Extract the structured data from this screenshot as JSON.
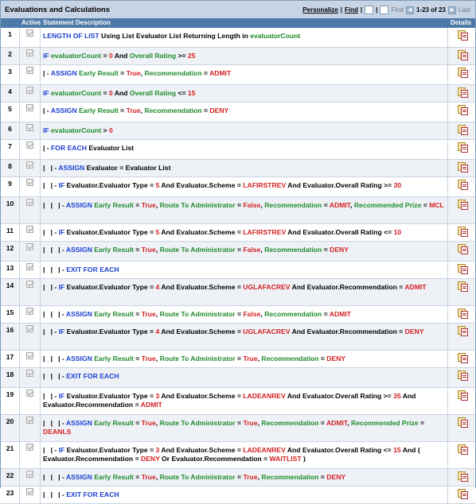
{
  "title": "Evaluations and Calculations",
  "nav": {
    "personalize": "Personalize",
    "find": "Find",
    "first": "First",
    "range": "1-23 of 23",
    "last": "Last"
  },
  "headers": {
    "active": "Active",
    "description": "Statement Description",
    "details": "Details"
  },
  "rows": [
    {
      "num": "1",
      "height": 24,
      "tokens": [
        [
          "k",
          "LENGTH OF LIST"
        ],
        [
          "t",
          " Using "
        ],
        [
          "t",
          "List Evaluator List"
        ],
        [
          "t",
          " Returning Length in "
        ],
        [
          "f",
          "evaluatorCount"
        ]
      ]
    },
    {
      "num": "2",
      "height": 21,
      "tokens": [
        [
          "k",
          "IF "
        ],
        [
          "f",
          "evaluatorCount"
        ],
        [
          "t",
          " = "
        ],
        [
          "v",
          "0"
        ],
        [
          "t",
          " And "
        ],
        [
          "f",
          "Overall Rating"
        ],
        [
          "t",
          " >= "
        ],
        [
          "v",
          "25"
        ]
      ]
    },
    {
      "num": "3",
      "height": 24,
      "tokens": [
        [
          "t",
          "| - "
        ],
        [
          "k",
          "ASSIGN "
        ],
        [
          "f",
          "Early Result"
        ],
        [
          "t",
          " = "
        ],
        [
          "v",
          "True"
        ],
        [
          "t",
          ", "
        ],
        [
          "f",
          "Recommendation"
        ],
        [
          "t",
          " = "
        ],
        [
          "v",
          "ADMIT"
        ]
      ]
    },
    {
      "num": "4",
      "height": 21,
      "tokens": [
        [
          "k",
          "IF "
        ],
        [
          "f",
          "evaluatorCount"
        ],
        [
          "t",
          " = "
        ],
        [
          "v",
          "0"
        ],
        [
          "t",
          " And "
        ],
        [
          "f",
          "Overall Rating"
        ],
        [
          "t",
          " <= "
        ],
        [
          "v",
          "15"
        ]
      ]
    },
    {
      "num": "5",
      "height": 24,
      "tokens": [
        [
          "t",
          "| - "
        ],
        [
          "k",
          "ASSIGN "
        ],
        [
          "f",
          "Early Result"
        ],
        [
          "t",
          " = "
        ],
        [
          "v",
          "True"
        ],
        [
          "t",
          ", "
        ],
        [
          "f",
          "Recommendation"
        ],
        [
          "t",
          " = "
        ],
        [
          "v",
          "DENY"
        ]
      ]
    },
    {
      "num": "6",
      "height": 21,
      "tokens": [
        [
          "k",
          "IF "
        ],
        [
          "f",
          "evaluatorCount"
        ],
        [
          "t",
          " > "
        ],
        [
          "v",
          "0"
        ]
      ]
    },
    {
      "num": "7",
      "height": 24,
      "tokens": [
        [
          "t",
          "| - "
        ],
        [
          "k",
          "FOR EACH "
        ],
        [
          "t",
          "Evaluator List"
        ]
      ]
    },
    {
      "num": "8",
      "height": 21,
      "tokens": [
        [
          "t",
          "|   | - "
        ],
        [
          "k",
          "ASSIGN "
        ],
        [
          "t",
          "Evaluator"
        ],
        [
          "t",
          " = "
        ],
        [
          "t",
          "Evaluator List"
        ]
      ]
    },
    {
      "num": "9",
      "height": 24,
      "tokens": [
        [
          "t",
          "|   | - "
        ],
        [
          "k",
          "IF "
        ],
        [
          "t",
          "Evaluator.Evaluator Type"
        ],
        [
          "t",
          " = "
        ],
        [
          "v",
          "5"
        ],
        [
          "t",
          " And "
        ],
        [
          "t",
          "Evaluator.Scheme"
        ],
        [
          "t",
          " = "
        ],
        [
          "v",
          "LAFIRSTREV"
        ],
        [
          "t",
          " And "
        ],
        [
          "t",
          "Evaluator.Overall Rating"
        ],
        [
          "t",
          " >= "
        ],
        [
          "v",
          "30"
        ]
      ]
    },
    {
      "num": "10",
      "height": 33,
      "tokens": [
        [
          "t",
          "|   |   | - "
        ],
        [
          "k",
          "ASSIGN "
        ],
        [
          "f",
          "Early Result"
        ],
        [
          "t",
          " = "
        ],
        [
          "v",
          "True"
        ],
        [
          "t",
          ", "
        ],
        [
          "f",
          "Route To Administrator"
        ],
        [
          "t",
          " = "
        ],
        [
          "v",
          "False"
        ],
        [
          "t",
          ", "
        ],
        [
          "f",
          "Recommendation"
        ],
        [
          "t",
          " = "
        ],
        [
          "v",
          "ADMIT"
        ],
        [
          "t",
          ", "
        ],
        [
          "f",
          "Recommended Prize"
        ],
        [
          "t",
          " = "
        ],
        [
          "v",
          "MCL"
        ]
      ]
    },
    {
      "num": "11",
      "height": 21,
      "tokens": [
        [
          "t",
          "|   | - "
        ],
        [
          "k",
          "IF "
        ],
        [
          "t",
          "Evaluator.Evaluator Type"
        ],
        [
          "t",
          " = "
        ],
        [
          "v",
          "5"
        ],
        [
          "t",
          " And "
        ],
        [
          "t",
          "Evaluator.Scheme"
        ],
        [
          "t",
          " = "
        ],
        [
          "v",
          "LAFIRSTREV"
        ],
        [
          "t",
          " And "
        ],
        [
          "t",
          "Evaluator.Overall Rating"
        ],
        [
          "t",
          " <= "
        ],
        [
          "v",
          "10"
        ]
      ]
    },
    {
      "num": "12",
      "height": 24,
      "tokens": [
        [
          "t",
          "|   |   | - "
        ],
        [
          "k",
          "ASSIGN "
        ],
        [
          "f",
          "Early Result"
        ],
        [
          "t",
          " = "
        ],
        [
          "v",
          "True"
        ],
        [
          "t",
          ", "
        ],
        [
          "f",
          "Route To Administrator"
        ],
        [
          "t",
          " = "
        ],
        [
          "v",
          "False"
        ],
        [
          "t",
          ", "
        ],
        [
          "f",
          "Recommendation"
        ],
        [
          "t",
          " = "
        ],
        [
          "v",
          "DENY"
        ]
      ]
    },
    {
      "num": "13",
      "height": 21,
      "tokens": [
        [
          "t",
          "|   |   | - "
        ],
        [
          "k",
          "EXIT FOR EACH"
        ]
      ]
    },
    {
      "num": "14",
      "height": 33,
      "tokens": [
        [
          "t",
          "|   | - "
        ],
        [
          "k",
          "IF "
        ],
        [
          "t",
          "Evaluator.Evaluator Type"
        ],
        [
          "t",
          " = "
        ],
        [
          "v",
          "4"
        ],
        [
          "t",
          " And "
        ],
        [
          "t",
          "Evaluator.Scheme"
        ],
        [
          "t",
          " = "
        ],
        [
          "v",
          "UGLAFACREV"
        ],
        [
          "t",
          " And "
        ],
        [
          "t",
          "Evaluator.Recommendation"
        ],
        [
          "t",
          " = "
        ],
        [
          "v",
          "ADMIT"
        ]
      ]
    },
    {
      "num": "15",
      "height": 21,
      "tokens": [
        [
          "t",
          "|   |   | - "
        ],
        [
          "k",
          "ASSIGN "
        ],
        [
          "f",
          "Early Result"
        ],
        [
          "t",
          " = "
        ],
        [
          "v",
          "True"
        ],
        [
          "t",
          ", "
        ],
        [
          "f",
          "Route To Administrator"
        ],
        [
          "t",
          " = "
        ],
        [
          "v",
          "False"
        ],
        [
          "t",
          ", "
        ],
        [
          "f",
          "Recommendation"
        ],
        [
          "t",
          " = "
        ],
        [
          "v",
          "ADMIT"
        ]
      ]
    },
    {
      "num": "16",
      "height": 33,
      "tokens": [
        [
          "t",
          "|   | - "
        ],
        [
          "k",
          "IF "
        ],
        [
          "t",
          "Evaluator.Evaluator Type"
        ],
        [
          "t",
          " = "
        ],
        [
          "v",
          "4"
        ],
        [
          "t",
          " And "
        ],
        [
          "t",
          "Evaluator.Scheme"
        ],
        [
          "t",
          " = "
        ],
        [
          "v",
          "UGLAFACREV"
        ],
        [
          "t",
          " And "
        ],
        [
          "t",
          "Evaluator.Recommendation"
        ],
        [
          "t",
          " = "
        ],
        [
          "v",
          "DENY"
        ]
      ]
    },
    {
      "num": "17",
      "height": 21,
      "tokens": [
        [
          "t",
          "|   |   | - "
        ],
        [
          "k",
          "ASSIGN "
        ],
        [
          "f",
          "Early Result"
        ],
        [
          "t",
          " = "
        ],
        [
          "v",
          "True"
        ],
        [
          "t",
          ", "
        ],
        [
          "f",
          "Route To Administrator"
        ],
        [
          "t",
          " = "
        ],
        [
          "v",
          "True"
        ],
        [
          "t",
          ", "
        ],
        [
          "f",
          "Recommendation"
        ],
        [
          "t",
          " = "
        ],
        [
          "v",
          "DENY"
        ]
      ]
    },
    {
      "num": "18",
      "height": 24,
      "tokens": [
        [
          "t",
          "|   |   | - "
        ],
        [
          "k",
          "EXIT FOR EACH"
        ]
      ]
    },
    {
      "num": "19",
      "height": 33,
      "tokens": [
        [
          "t",
          "|   | - "
        ],
        [
          "k",
          "IF "
        ],
        [
          "t",
          "Evaluator.Evaluator Type"
        ],
        [
          "t",
          " = "
        ],
        [
          "v",
          "3"
        ],
        [
          "t",
          " And "
        ],
        [
          "t",
          "Evaluator.Scheme"
        ],
        [
          "t",
          " = "
        ],
        [
          "v",
          "LADEANREV"
        ],
        [
          "t",
          " And "
        ],
        [
          "t",
          "Evaluator.Overall Rating"
        ],
        [
          "t",
          " >= "
        ],
        [
          "v",
          "35"
        ],
        [
          "t",
          " And "
        ],
        [
          "t",
          "Evaluator.Recommendation"
        ],
        [
          "t",
          " = "
        ],
        [
          "v",
          "ADMIT"
        ]
      ]
    },
    {
      "num": "20",
      "height": 33,
      "tokens": [
        [
          "t",
          "|   |   | - "
        ],
        [
          "k",
          "ASSIGN "
        ],
        [
          "f",
          "Early Result"
        ],
        [
          "t",
          " = "
        ],
        [
          "v",
          "True"
        ],
        [
          "t",
          ", "
        ],
        [
          "f",
          "Route To Administrator"
        ],
        [
          "t",
          " = "
        ],
        [
          "v",
          "True"
        ],
        [
          "t",
          ", "
        ],
        [
          "f",
          "Recommendation"
        ],
        [
          "t",
          " = "
        ],
        [
          "v",
          "ADMIT"
        ],
        [
          "t",
          ", "
        ],
        [
          "f",
          "Recommended Prize"
        ],
        [
          "t",
          " = "
        ],
        [
          "v",
          "DEANLS"
        ]
      ]
    },
    {
      "num": "21",
      "height": 33,
      "tokens": [
        [
          "t",
          "|   | - "
        ],
        [
          "k",
          "IF "
        ],
        [
          "t",
          "Evaluator.Evaluator Type"
        ],
        [
          "t",
          " = "
        ],
        [
          "v",
          "3"
        ],
        [
          "t",
          " And "
        ],
        [
          "t",
          "Evaluator.Scheme"
        ],
        [
          "t",
          " = "
        ],
        [
          "v",
          "LADEANREV"
        ],
        [
          "t",
          " And "
        ],
        [
          "t",
          "Evaluator.Overall Rating"
        ],
        [
          "t",
          " <= "
        ],
        [
          "v",
          "15"
        ],
        [
          "t",
          " And ( "
        ],
        [
          "t",
          "Evaluator.Recommendation"
        ],
        [
          "t",
          " = "
        ],
        [
          "v",
          "DENY"
        ],
        [
          "t",
          " Or "
        ],
        [
          "t",
          "Evaluator.Recommendation"
        ],
        [
          "t",
          " = "
        ],
        [
          "v",
          "WAITLIST"
        ],
        [
          "t",
          " )"
        ]
      ]
    },
    {
      "num": "22",
      "height": 21,
      "tokens": [
        [
          "t",
          "|   |   | - "
        ],
        [
          "k",
          "ASSIGN "
        ],
        [
          "f",
          "Early Result"
        ],
        [
          "t",
          " = "
        ],
        [
          "v",
          "True"
        ],
        [
          "t",
          ", "
        ],
        [
          "f",
          "Route To Administrator"
        ],
        [
          "t",
          " = "
        ],
        [
          "v",
          "True"
        ],
        [
          "t",
          ", "
        ],
        [
          "f",
          "Recommendation"
        ],
        [
          "t",
          " = "
        ],
        [
          "v",
          "DENY"
        ]
      ]
    },
    {
      "num": "23",
      "height": 21,
      "tokens": [
        [
          "t",
          "|   |   | - "
        ],
        [
          "k",
          "EXIT FOR EACH"
        ]
      ]
    }
  ]
}
